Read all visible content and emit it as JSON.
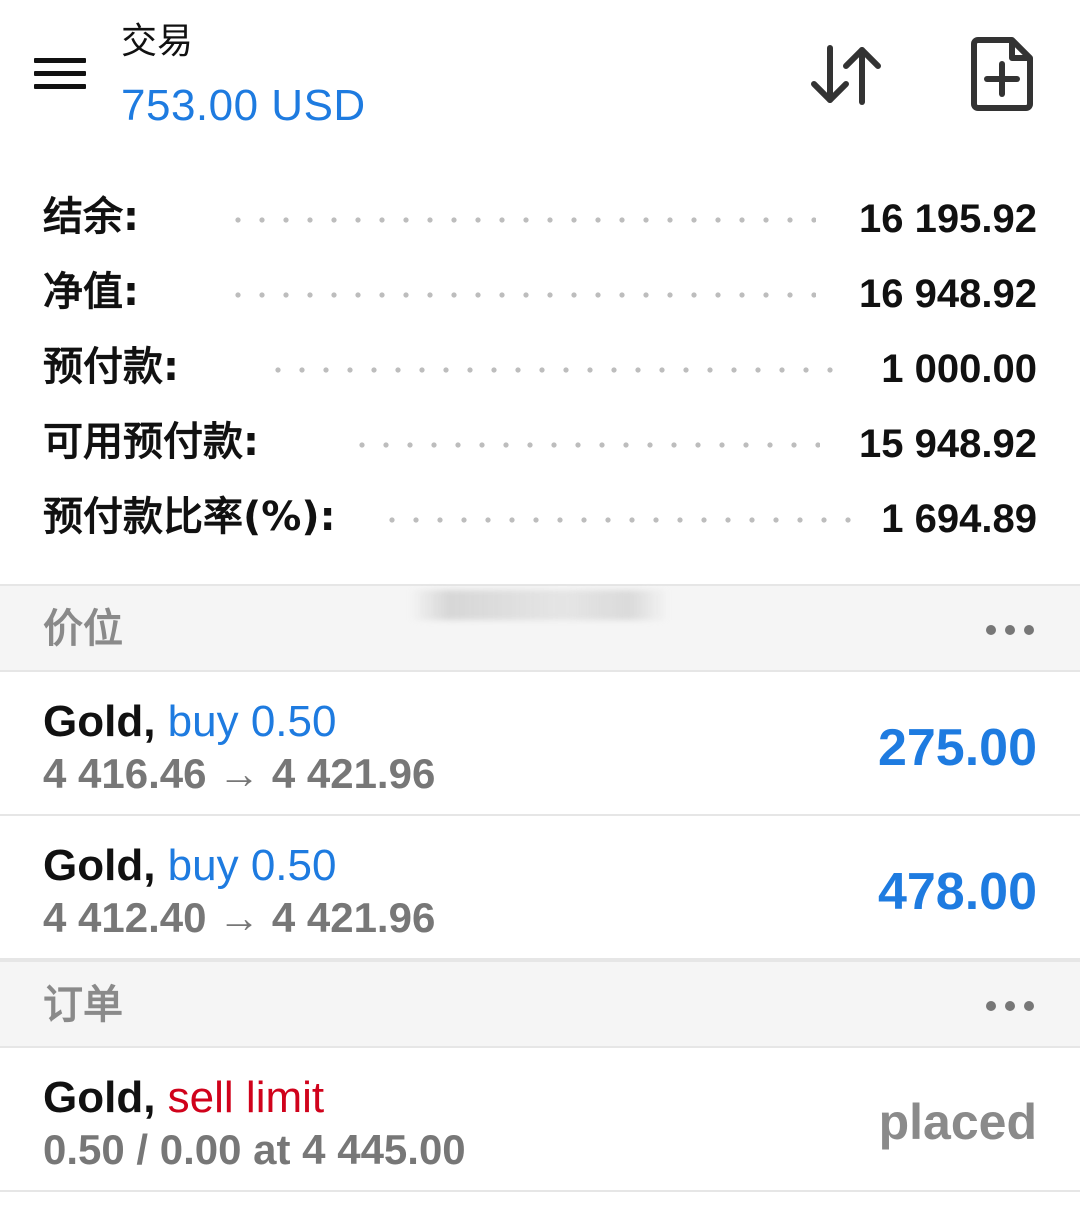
{
  "header": {
    "title": "交易",
    "balance_subtitle": "753.00 USD"
  },
  "summary": [
    {
      "label": "结余:",
      "value": "16 195.92"
    },
    {
      "label": "净值:",
      "value": "16 948.92"
    },
    {
      "label": "预付款:",
      "value": "1 000.00"
    },
    {
      "label": "可用预付款:",
      "value": "15 948.92"
    },
    {
      "label": "预付款比率(%):",
      "value": "1 694.89"
    }
  ],
  "positions": {
    "title": "价位",
    "items": [
      {
        "symbol": "Gold,",
        "direction": "buy 0.50",
        "prices": "4 416.46 → 4 421.96",
        "profit": "275.00"
      },
      {
        "symbol": "Gold,",
        "direction": "buy 0.50",
        "prices": "4 412.40 → 4 421.96",
        "profit": "478.00"
      }
    ]
  },
  "orders": {
    "title": "订单",
    "items": [
      {
        "symbol": "Gold,",
        "direction": "sell limit",
        "details": "0.50 / 0.00 at 4 445.00",
        "status": "placed"
      }
    ]
  },
  "colors": {
    "accent_blue": "#1e7be0",
    "sell_red": "#d0021b",
    "muted_gray": "#777777"
  }
}
